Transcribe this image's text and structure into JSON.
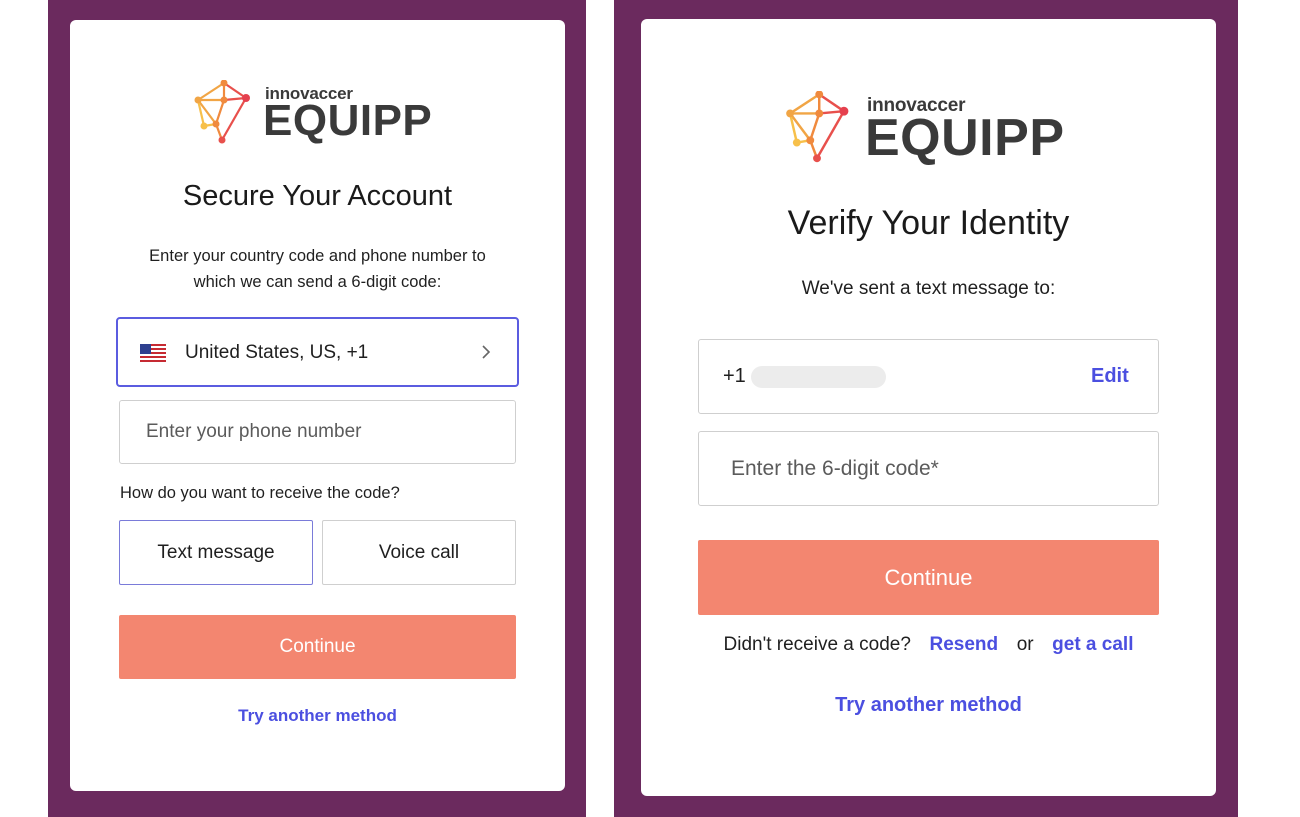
{
  "left_screen": {
    "logo": {
      "brand": "innovaccer",
      "product": "EQUIPP"
    },
    "title": "Secure Your Account",
    "instructions_line1": "Enter your country code and phone number to",
    "instructions_line2": "which we can send a 6-digit code:",
    "country_selector": {
      "value": "United States, US, +1",
      "flag_icon": "us-flag-icon",
      "chevron_icon": "chevron-right-icon"
    },
    "phone_input": {
      "placeholder": "Enter your phone number",
      "value": ""
    },
    "method_question": "How do you want to receive the code?",
    "methods": [
      {
        "label": "Text message",
        "selected": true
      },
      {
        "label": "Voice call",
        "selected": false
      }
    ],
    "continue_label": "Continue",
    "try_another_label": "Try another method"
  },
  "right_screen": {
    "logo": {
      "brand": "innovaccer",
      "product": "EQUIPP"
    },
    "title": "Verify Your Identity",
    "sent_text": "We've sent a text message to:",
    "phone_prefix": "+1",
    "edit_label": "Edit",
    "code_input": {
      "placeholder": "Enter the 6-digit code*",
      "value": ""
    },
    "continue_label": "Continue",
    "resend_prompt": "Didn't receive a code?",
    "resend_label": "Resend",
    "or_text": "or",
    "get_call_label": "get a call",
    "try_another_label": "Try another method"
  },
  "colors": {
    "frame": "#6b2a5e",
    "primary_button": "#f38670",
    "link": "#4b4fe0",
    "focus_border": "#5b5ce0"
  }
}
